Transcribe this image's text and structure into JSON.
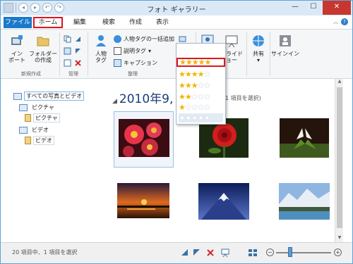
{
  "window": {
    "title": "フォト ギャラリー"
  },
  "tabs": [
    {
      "label": "ファイル"
    },
    {
      "label": "ホーム"
    },
    {
      "label": "編集"
    },
    {
      "label": "検索"
    },
    {
      "label": "作成"
    },
    {
      "label": "表示"
    }
  ],
  "ribbon": {
    "groups": {
      "new": {
        "label": "新規作成",
        "import_label": "インポート",
        "import_line1": "イン",
        "import_line2": "ポート",
        "folder_line1": "フォルダー",
        "folder_line2": "の作成"
      },
      "manage": {
        "label": "管理"
      },
      "organize": {
        "label": "整理",
        "people_tag_line1": "人物",
        "people_tag_line2": "タグ",
        "batch_people": "人物タグの一括追加",
        "description_tag": "説明タグ",
        "caption": "キャプション"
      },
      "share": {
        "tag_partial": "タグ",
        "slideshow_partial": "スライド",
        "slideshow_partial2": "ョー",
        "share_label": "共有",
        "signin_label": "サインイン"
      }
    },
    "rating_dropdown": {
      "rows": [
        {
          "filled": 5,
          "empty": 0
        },
        {
          "filled": 4,
          "empty": 1
        },
        {
          "filled": 3,
          "empty": 2
        },
        {
          "filled": 2,
          "empty": 3
        },
        {
          "filled": 1,
          "empty": 4
        },
        {
          "filled": 0,
          "empty": 5
        }
      ],
      "highlighted_row": 0
    }
  },
  "tree": {
    "items": [
      {
        "label": "すべての写真とビデオ"
      },
      {
        "label": "ピクチャ"
      },
      {
        "label": "ピクチャ"
      },
      {
        "label": "ビデオ"
      },
      {
        "label": "ビデオ"
      }
    ]
  },
  "content": {
    "date_header": "2010年9,",
    "selection_info": "1 項目を選択)",
    "photos": [
      {
        "name": "pink-flowers"
      },
      {
        "name": "red-rose"
      },
      {
        "name": "white-lily"
      },
      {
        "name": "sunset-pier"
      },
      {
        "name": "mount-fuji"
      },
      {
        "name": "mountain-lake"
      }
    ]
  },
  "status": {
    "text": "20 項目中、1 項目を選択"
  }
}
